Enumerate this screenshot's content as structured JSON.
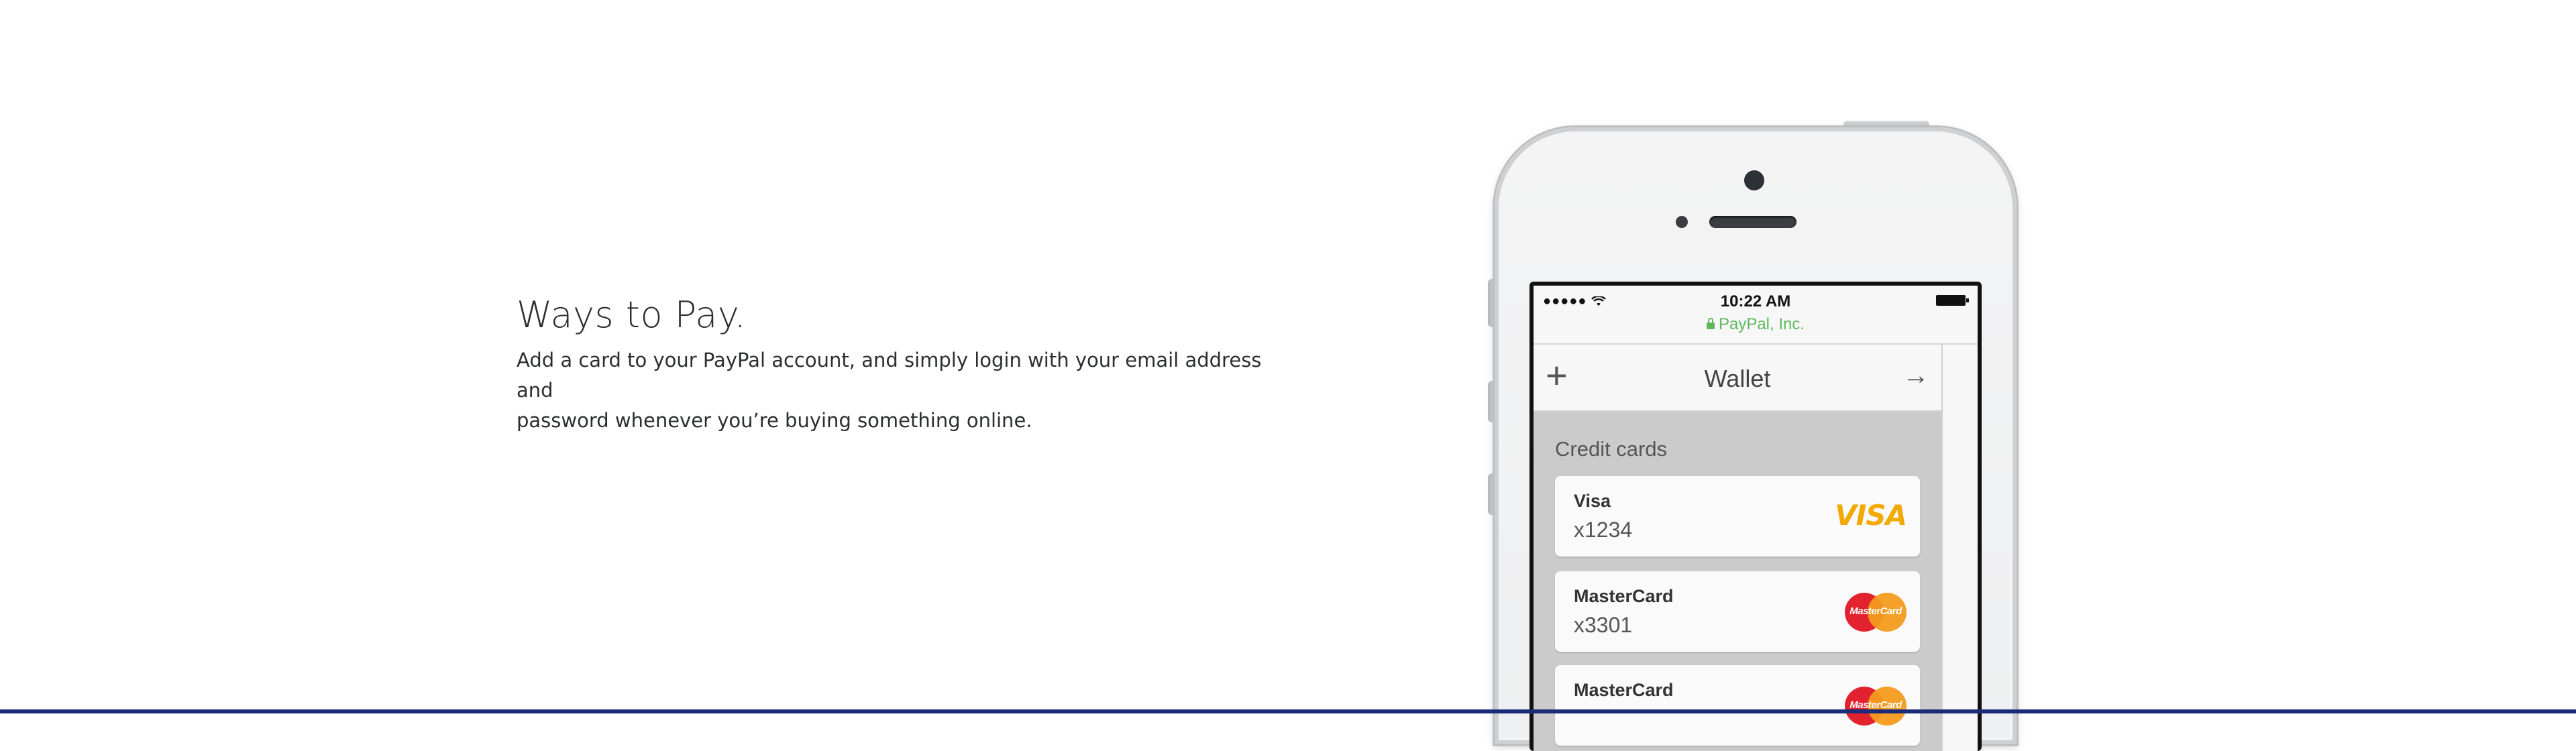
{
  "section": {
    "heading": "Ways to Pay.",
    "body_line1": "Add a card to your PayPal account, and simply login with your email address and",
    "body_line2": "password whenever you’re buying something online."
  },
  "phone": {
    "status_bar": {
      "signal": "●●●●●",
      "time": "10:22 AM",
      "site": "PayPal, Inc."
    },
    "nav": {
      "title": "Wallet",
      "add": "+",
      "forward": "→"
    },
    "wallet": {
      "section_title": "Credit cards",
      "cards": [
        {
          "name": "Visa",
          "number": "x1234",
          "brand": "VISA"
        },
        {
          "name": "MasterCard",
          "number": "x3301",
          "brand": "MasterCard"
        },
        {
          "name": "MasterCard",
          "number": "",
          "brand": "MasterCard"
        }
      ]
    }
  },
  "colors": {
    "footer_bar": "#1b2a79",
    "secure_green": "#5cb85c",
    "visa_blue": "#1a3b8b"
  }
}
